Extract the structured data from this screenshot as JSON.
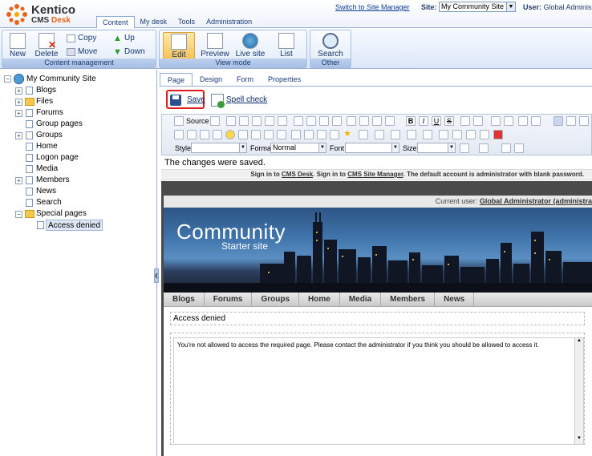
{
  "app": {
    "logo_line1": "Kentico",
    "logo_cms": "CMS",
    "logo_desk": "Desk"
  },
  "top_tabs": [
    "Content",
    "My desk",
    "Tools",
    "Administration"
  ],
  "header": {
    "switch_link": "Switch to Site Manager",
    "site_label": "Site:",
    "site_value": "My Community Site",
    "user_label": "User:",
    "user_value": "Global Adminis"
  },
  "ribbon": {
    "content_management": {
      "caption": "Content management",
      "new": "New",
      "delete": "Delete",
      "copy": "Copy",
      "move": "Move",
      "up": "Up",
      "down": "Down"
    },
    "view_mode": {
      "caption": "View mode",
      "edit": "Edit",
      "preview": "Preview",
      "live_site": "Live site",
      "list": "List"
    },
    "other": {
      "caption": "Other",
      "search": "Search"
    }
  },
  "tree": {
    "root": "My Community Site",
    "items": [
      "Blogs",
      "Files",
      "Forums",
      "Group pages",
      "Groups",
      "Home",
      "Logon page",
      "Media",
      "Members",
      "News",
      "Search",
      "Special pages"
    ],
    "child": "Access denied"
  },
  "page_tabs": [
    "Page",
    "Design",
    "Form",
    "Properties"
  ],
  "actions": {
    "save": "Save",
    "spell_check": "Spell check"
  },
  "editor": {
    "source": "Source",
    "style_label": "Style",
    "format_label": "Format",
    "format_value": "Normal",
    "font_label": "Font",
    "size_label": "Size"
  },
  "message": "The changes were saved.",
  "signin": {
    "p1": "Sign in to ",
    "cms_desk": "CMS Desk",
    "p2": ". Sign in to ",
    "site_manager": "CMS Site Manager",
    "p3": ". The default account is administrator with blank password."
  },
  "site": {
    "current_user_label": "Current user: ",
    "current_user": "Global Administrator (administra",
    "title": "Community",
    "subtitle": "Starter site",
    "nav": [
      "Blogs",
      "Forums",
      "Groups",
      "Home",
      "Media",
      "Members",
      "News"
    ],
    "breadcrumb": "Access denied",
    "content_text": "You're not allowed to access the required page. Please contact the administrator if you think you should be allowed to access it."
  },
  "colors": {
    "accent": "#e8631b",
    "save_highlight": "#e21c1c",
    "ribbon_caption": "#a8c0e6"
  }
}
